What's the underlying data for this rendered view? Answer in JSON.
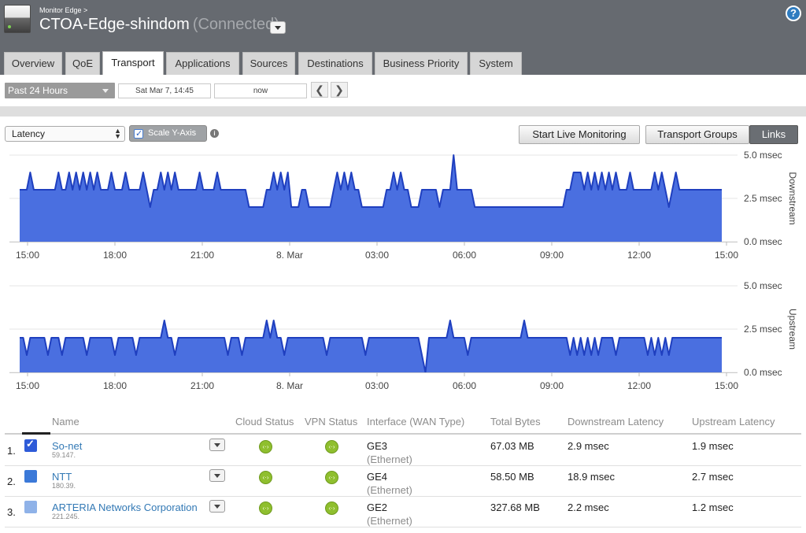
{
  "header": {
    "breadcrumb": "Monitor Edge >",
    "device_name": "CTOA-Edge-shindom",
    "connection_status": "(Connected)",
    "help_label": "?"
  },
  "tabs": [
    "Overview",
    "QoE",
    "Transport",
    "Applications",
    "Sources",
    "Destinations",
    "Business Priority",
    "System"
  ],
  "active_tab": "Transport",
  "time_range": {
    "selected": "Past 24 Hours",
    "start": "Sat Mar 7, 14:45",
    "end": "now",
    "prev_label": "❮",
    "next_label": "❯"
  },
  "controls": {
    "metric": "Latency",
    "scale_y_axis_label": "Scale Y-Axis",
    "scale_y_axis_checked": true,
    "info_label": "i",
    "live_monitoring_label": "Start Live Monitoring",
    "transport_groups_label": "Transport Groups",
    "links_label": "Links",
    "active_view": "Links"
  },
  "chart_data": [
    {
      "type": "area",
      "ylabel": "Downstream",
      "yticks": [
        "5.0 msec",
        "2.5 msec",
        "0.0 msec"
      ],
      "ylim": [
        0,
        5
      ],
      "xticks": [
        "15:00",
        "18:00",
        "21:00",
        "8. Mar",
        "03:00",
        "06:00",
        "09:00",
        "12:00",
        "15:00"
      ],
      "color": "#4a6fe0",
      "line_color": "#1f3fbf",
      "values": [
        3,
        3,
        3,
        4,
        3,
        3,
        3,
        3,
        3,
        3,
        3,
        4,
        3,
        3,
        4,
        3,
        4,
        3,
        4,
        3,
        4,
        3,
        4,
        3,
        3,
        3,
        4,
        3,
        3,
        3,
        4,
        3,
        3,
        3,
        3,
        4,
        3,
        2,
        3,
        3,
        4,
        3,
        4,
        3,
        4,
        3,
        3,
        3,
        3,
        3,
        3,
        4,
        3,
        3,
        3,
        3,
        4,
        3,
        3,
        3,
        3,
        3,
        3,
        3,
        3,
        2,
        2,
        2,
        2,
        2,
        3,
        3,
        4,
        3,
        4,
        3,
        4,
        2,
        2,
        2,
        3,
        3,
        2,
        2,
        2,
        2,
        2,
        2,
        2,
        3,
        4,
        3,
        4,
        3,
        4,
        3,
        3,
        2,
        2,
        2,
        2,
        2,
        2,
        2,
        3,
        3,
        4,
        3,
        4,
        3,
        3,
        2,
        2,
        2,
        3,
        3,
        3,
        3,
        3,
        2,
        3,
        3,
        3,
        5,
        3,
        3,
        3,
        3,
        3,
        2,
        2,
        2,
        2,
        2,
        2,
        2,
        2,
        2,
        2,
        2,
        2,
        2,
        2,
        2,
        2,
        2,
        2,
        2,
        2,
        2,
        2,
        2,
        2,
        2,
        2,
        3,
        3,
        4,
        4,
        4,
        3,
        4,
        3,
        4,
        3,
        4,
        3,
        4,
        3,
        4,
        3,
        3,
        3,
        4,
        3,
        3,
        3,
        3,
        3,
        3,
        4,
        3,
        4,
        3,
        2,
        3,
        4,
        3,
        3,
        3,
        3,
        3,
        3,
        3,
        3,
        3,
        3,
        3,
        3,
        3
      ]
    },
    {
      "type": "area",
      "ylabel": "Upstream",
      "yticks": [
        "5.0 msec",
        "2.5 msec",
        "0.0 msec"
      ],
      "ylim": [
        0,
        5
      ],
      "xticks": [
        "15:00",
        "18:00",
        "21:00",
        "8. Mar",
        "03:00",
        "06:00",
        "09:00",
        "12:00",
        "15:00"
      ],
      "color": "#4a6fe0",
      "line_color": "#1f3fbf",
      "values": [
        2,
        2,
        1,
        2,
        2,
        2,
        2,
        2,
        1,
        2,
        2,
        2,
        1,
        2,
        2,
        2,
        2,
        2,
        2,
        1,
        2,
        2,
        2,
        2,
        2,
        2,
        2,
        1,
        2,
        2,
        2,
        2,
        2,
        1,
        2,
        2,
        2,
        2,
        2,
        2,
        2,
        3,
        2,
        2,
        1,
        2,
        2,
        2,
        2,
        2,
        2,
        2,
        2,
        2,
        2,
        2,
        2,
        2,
        2,
        1,
        2,
        2,
        2,
        1,
        2,
        2,
        2,
        2,
        2,
        2,
        3,
        2,
        3,
        2,
        2,
        1,
        2,
        2,
        2,
        2,
        2,
        2,
        2,
        2,
        2,
        2,
        2,
        1,
        2,
        2,
        2,
        2,
        2,
        2,
        2,
        2,
        2,
        2,
        1,
        2,
        2,
        2,
        2,
        2,
        2,
        2,
        2,
        2,
        2,
        2,
        2,
        2,
        2,
        2,
        1,
        0,
        2,
        2,
        2,
        2,
        2,
        2,
        3,
        2,
        2,
        2,
        2,
        1,
        2,
        2,
        2,
        2,
        2,
        2,
        2,
        2,
        2,
        2,
        2,
        2,
        2,
        2,
        2,
        3,
        2,
        2,
        2,
        2,
        2,
        2,
        2,
        2,
        2,
        2,
        2,
        2,
        1,
        2,
        1,
        2,
        1,
        2,
        1,
        2,
        1,
        2,
        2,
        2,
        2,
        1,
        2,
        2,
        2,
        2,
        2,
        2,
        2,
        2,
        1,
        2,
        1,
        2,
        1,
        2,
        1,
        2,
        2,
        2,
        2,
        2,
        2,
        2,
        2,
        2,
        2,
        2,
        2,
        2,
        2,
        2
      ]
    }
  ],
  "table": {
    "headers": [
      "Name",
      "Cloud Status",
      "VPN Status",
      "Interface (WAN Type)",
      "Total Bytes",
      "Downstream Latency",
      "Upstream Latency"
    ],
    "rows": [
      {
        "num": "1.",
        "name": "So-net",
        "ip": "59.147.",
        "swatch": "#2e5bd8",
        "checked": true,
        "interface": "GE3",
        "wan": "(Ethernet)",
        "bytes": "67.03 MB",
        "down": "2.9 msec",
        "up": "1.9 msec"
      },
      {
        "num": "2.",
        "name": "NTT",
        "ip": "180.39.",
        "swatch": "#3b79d8",
        "checked": false,
        "interface": "GE4",
        "wan": "(Ethernet)",
        "bytes": "58.50 MB",
        "down": "18.9 msec",
        "up": "2.7 msec"
      },
      {
        "num": "3.",
        "name": "ARTERIA Networks Corporation",
        "ip": "221.245.",
        "swatch": "#8fb2e8",
        "checked": false,
        "interface": "GE2",
        "wan": "(Ethernet)",
        "bytes": "327.68 MB",
        "down": "2.2 msec",
        "up": "1.2 msec"
      }
    ],
    "status_glyph": "‹·›"
  }
}
